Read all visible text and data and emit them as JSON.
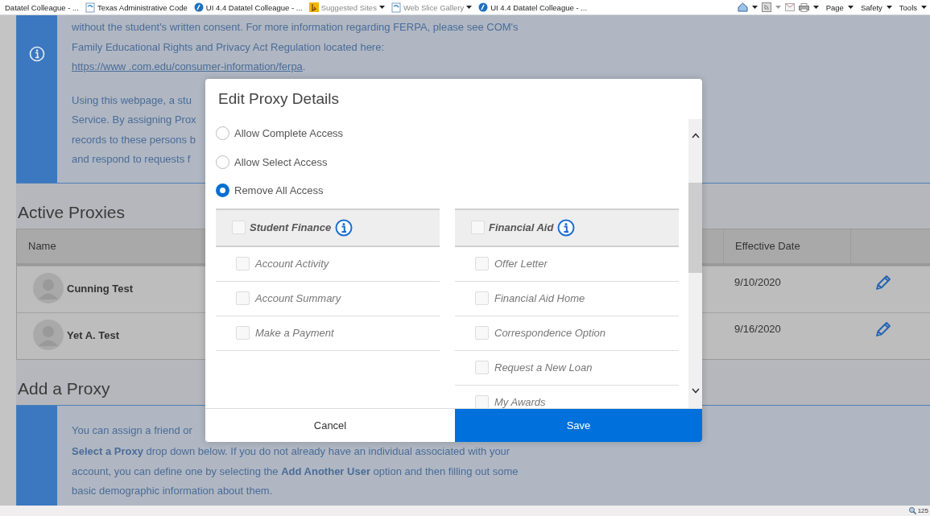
{
  "browser": {
    "favorites": [
      {
        "label": "Datatel Colleague - ...",
        "dropdown": false
      },
      {
        "label": "Texas Administrative Code",
        "dropdown": false
      },
      {
        "label": "UI 4.4 Datatel Colleague - ...",
        "dropdown": false
      },
      {
        "label": "Suggested Sites",
        "dropdown": true
      },
      {
        "label": "Web Slice Gallery",
        "dropdown": true
      },
      {
        "label": "UI 4.4 Datatel Colleague - ...",
        "dropdown": false
      }
    ],
    "commands": [
      "Page",
      "Safety",
      "Tools"
    ],
    "zoom": "125"
  },
  "notice": {
    "lines": [
      "without the student's written consent. For more information regarding FERPA, please see COM's",
      "Family Educational Rights and Privacy Act Regulation located here:"
    ],
    "link": "https://www .com.edu/consumer-information/ferpa",
    "link_after": ".",
    "cut_lines": [
      "Using this webpage, a stu",
      "Service. By assigning Prox",
      "records to these persons b",
      "and respond to requests f"
    ]
  },
  "active_proxies": {
    "heading": "Active Proxies",
    "columns": [
      "Name",
      "Effective Date"
    ],
    "rows": [
      {
        "name": "Cunning Test",
        "date": "9/10/2020"
      },
      {
        "name": "Yet A. Test",
        "date": "9/16/2020"
      }
    ]
  },
  "add_proxy": {
    "heading": "Add a Proxy",
    "cut_line": "You can assign a friend or",
    "lines": [
      "**Select a Proxy** drop down below. If you do not already have an individual associated with your",
      "account, you can define one by selecting the **Add Another User** option and then filling out some",
      "basic demographic information about them."
    ]
  },
  "modal": {
    "title": "Edit Proxy Details",
    "access_options": [
      {
        "label": "Allow Complete Access",
        "selected": false
      },
      {
        "label": "Allow Select Access",
        "selected": false
      },
      {
        "label": "Remove All Access",
        "selected": true
      }
    ],
    "groups": [
      {
        "title": "Student Finance",
        "checked": false,
        "items": [
          {
            "label": "Account Activity",
            "checked": false
          },
          {
            "label": "Account Summary",
            "checked": false
          },
          {
            "label": "Make a Payment",
            "checked": false
          }
        ]
      },
      {
        "title": "Financial Aid",
        "checked": false,
        "items": [
          {
            "label": "Offer Letter",
            "checked": false
          },
          {
            "label": "Financial Aid Home",
            "checked": false
          },
          {
            "label": "Correspondence Option",
            "checked": false
          },
          {
            "label": "Request a New Loan",
            "checked": false
          },
          {
            "label": "My Awards",
            "checked": false
          }
        ]
      }
    ],
    "cancel": "Cancel",
    "save": "Save"
  }
}
